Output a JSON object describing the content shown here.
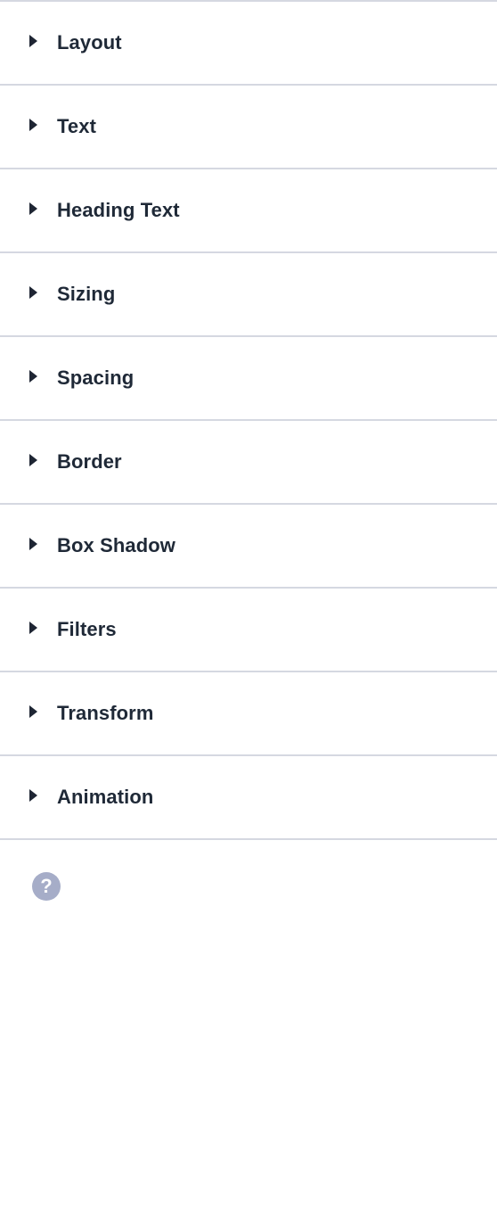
{
  "sections": [
    {
      "label": "Layout"
    },
    {
      "label": "Text"
    },
    {
      "label": "Heading Text"
    },
    {
      "label": "Sizing"
    },
    {
      "label": "Spacing"
    },
    {
      "label": "Border"
    },
    {
      "label": "Box Shadow"
    },
    {
      "label": "Filters"
    },
    {
      "label": "Transform"
    },
    {
      "label": "Animation"
    }
  ],
  "help": {
    "glyph": "?",
    "icon": "help-circle-icon"
  },
  "colors": {
    "divider": "#d5d8e1",
    "text": "#1f2937",
    "help_bg": "#a6adc8"
  }
}
